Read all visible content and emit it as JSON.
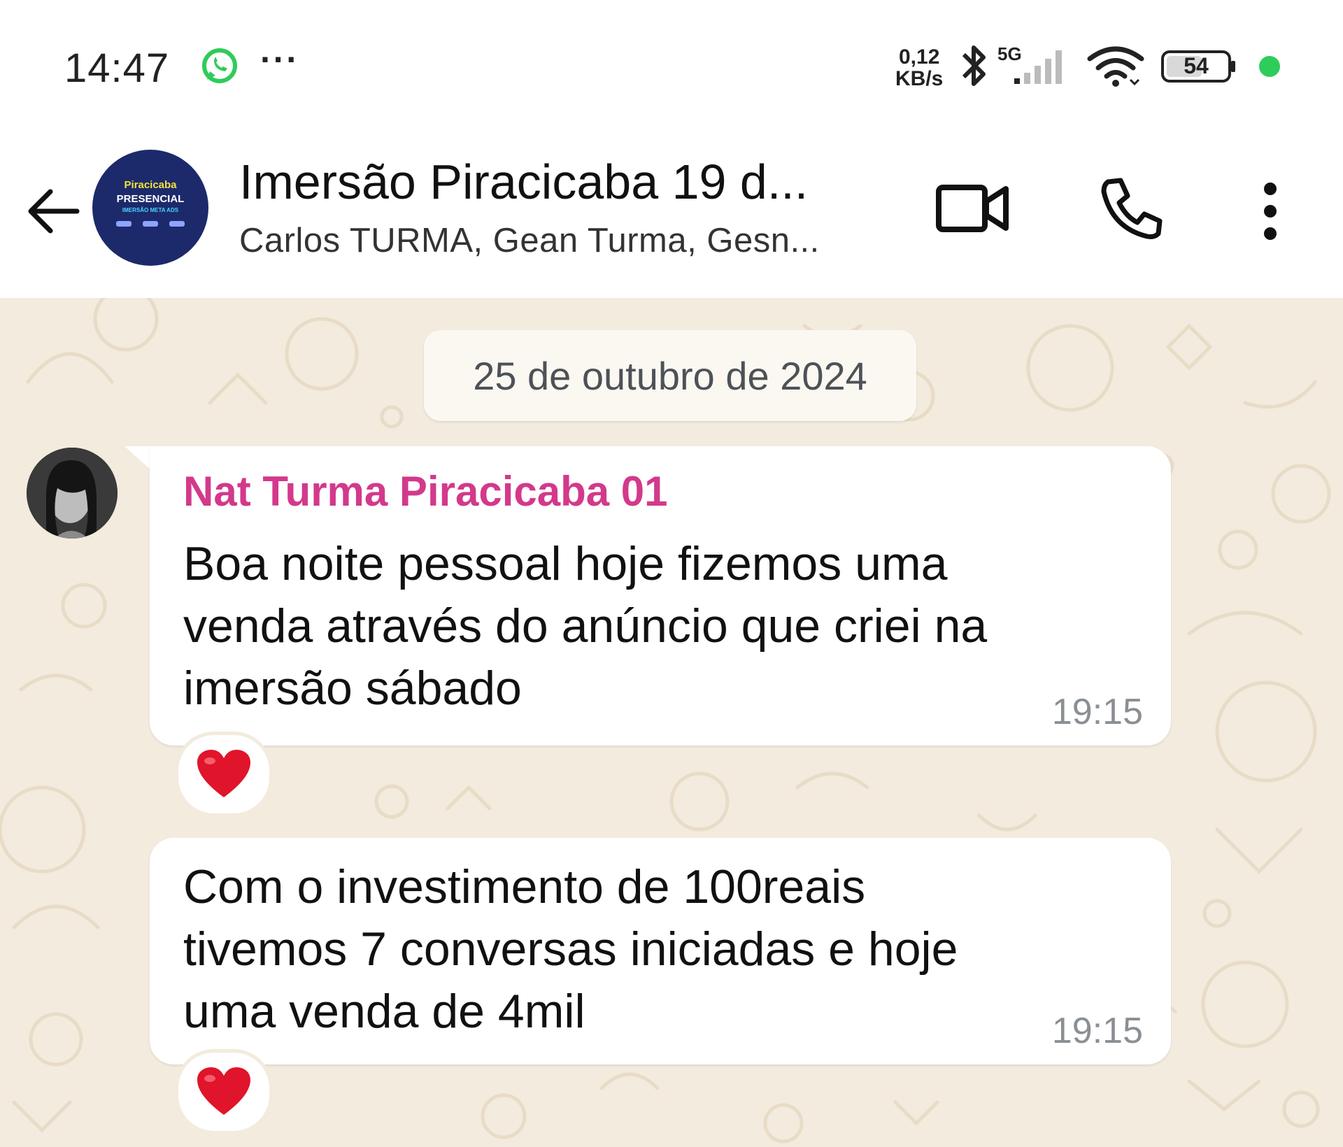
{
  "status_bar": {
    "time": "14:47",
    "more": "···",
    "net_speed_value": "0,12",
    "net_speed_unit": "KB/s",
    "network_type": "5G",
    "battery_level": "54",
    "icons": [
      "whatsapp-icon",
      "bluetooth-icon",
      "signal-icon",
      "wifi-icon",
      "battery-icon"
    ],
    "status_dot_color": "#2ecc5b"
  },
  "header": {
    "avatar_lines": [
      "Piracicaba",
      "PRESENCIAL",
      "IMERSÃO META ADS"
    ],
    "title": "Imersão Piracicaba 19 d...",
    "members": "Carlos TURMA, Gean Turma, Gesn...",
    "icons": [
      "back-arrow-icon",
      "video-call-icon",
      "phone-icon",
      "more-vert-icon"
    ]
  },
  "chat": {
    "date_chip": "25 de outubro de 2024",
    "messages": [
      {
        "sender": "Nat Turma Piracicaba 01",
        "sender_color": "#d3398b",
        "lines": [
          "Boa noite pessoal hoje fizemos uma",
          "venda através do anúncio que criei na",
          "imersão sábado"
        ],
        "time": "19:15",
        "reaction": "heart"
      },
      {
        "lines": [
          "Com o investimento de 100reais",
          "tivemos 7 conversas iniciadas e hoje",
          "uma venda de 4mil"
        ],
        "time": "19:15",
        "reaction": "heart"
      }
    ]
  },
  "colors": {
    "chat_background": "#f2ebde",
    "bubble": "#ffffff",
    "group_avatar_bg": "#1c2a6b"
  }
}
